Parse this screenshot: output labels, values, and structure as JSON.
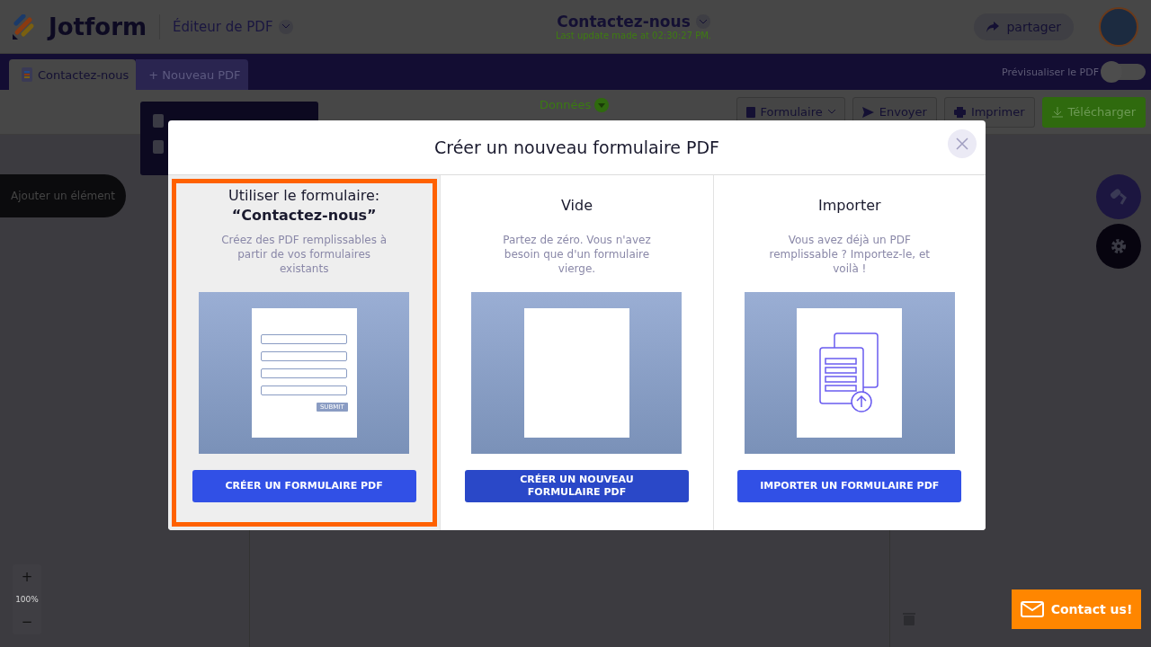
{
  "header": {
    "logo": "Jotform",
    "editor_menu": "Éditeur de PDF",
    "doc_title": "Contactez-nous",
    "last_update": "Last update made at 02:30:27 PM.",
    "share_button": "partager"
  },
  "tabs": [
    {
      "label": "Contactez-nous",
      "selected": true,
      "kind": "doc"
    },
    {
      "label": "+ Nouveau PDF",
      "selected": false,
      "kind": "new"
    }
  ],
  "preview": {
    "label": "Prévisualiser le PDF",
    "on": false
  },
  "toolbar": {
    "data_label": "Données",
    "buttons": [
      {
        "label": "Formulaire",
        "kind": "menu"
      },
      {
        "label": "Envoyer",
        "kind": "send"
      },
      {
        "label": "Imprimer",
        "kind": "print"
      },
      {
        "label": "Télécharger",
        "kind": "download"
      }
    ]
  },
  "add_element": "Ajouter un élément",
  "zoom": {
    "in": "+",
    "level": "100%",
    "out": "−"
  },
  "contact_button": "Contact us!",
  "modal": {
    "title": "Créer un nouveau formulaire PDF",
    "options": [
      {
        "title": "Utiliser le formulaire: **“Contactez-nous”**",
        "description": "Créez des PDF remplissables à partir de vos formulaires existants",
        "button": "CRÉER UN FORMULAIRE PDF",
        "kind": "form",
        "selected": true,
        "submit_label": "SUBMIT"
      },
      {
        "title": "Vide",
        "description": "Partez de zéro. Vous n'avez besoin que d'un formulaire vierge.",
        "button": "CRÉER UN NOUVEAU FORMULAIRE PDF",
        "kind": "blank",
        "selected": false
      },
      {
        "title": "Importer",
        "description": "Vous avez déjà un PDF remplissable ? Importez-le, et voilà !",
        "button": "IMPORTER UN FORMULAIRE PDF",
        "kind": "import",
        "selected": false
      }
    ]
  }
}
